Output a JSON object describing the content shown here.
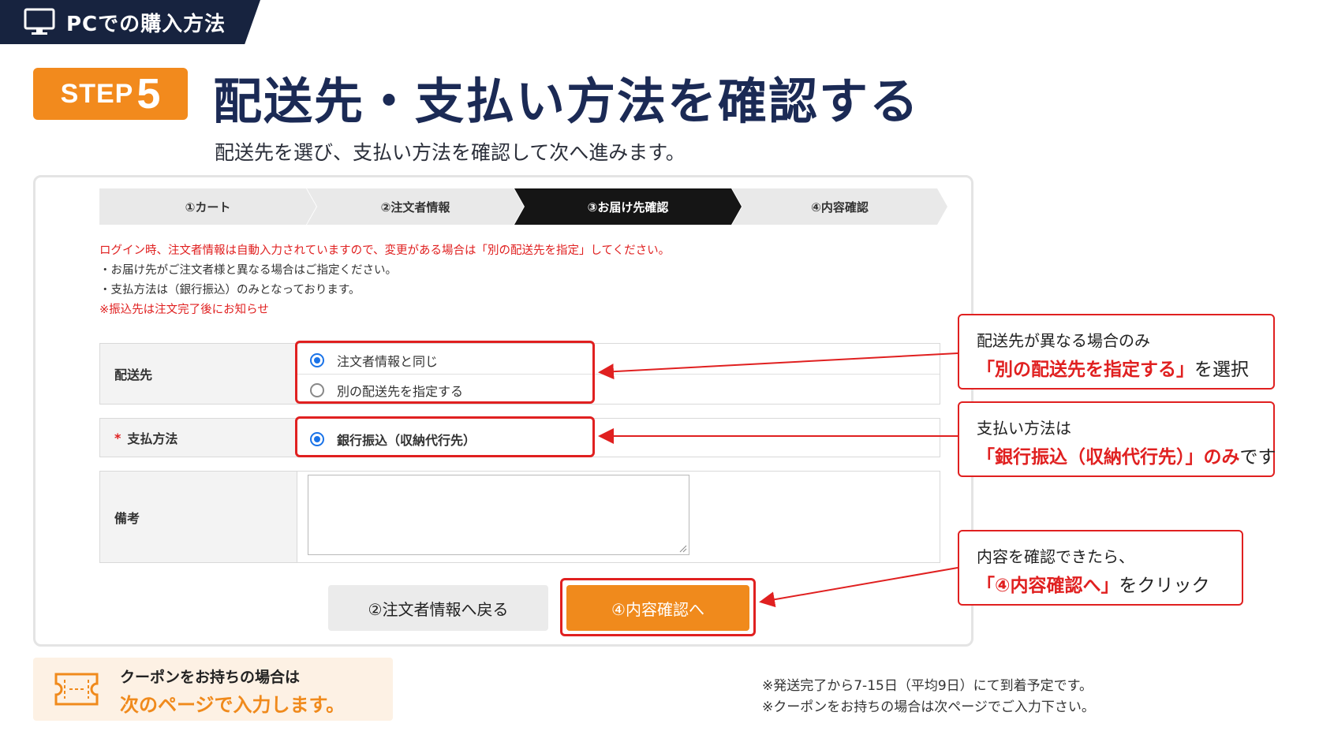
{
  "header": {
    "tab_label": "PCでの購入方法"
  },
  "step": {
    "word": "STEP",
    "number": "5"
  },
  "title": "配送先・支払い方法を確認する",
  "subtitle": "配送先を選び、支払い方法を確認して次へ進みます。",
  "progress": {
    "steps": [
      "①カート",
      "②注文者情報",
      "③お届け先確認",
      "④内容確認"
    ],
    "current": "③お届け先確認"
  },
  "notes": {
    "line1": "ログイン時、注文者情報は自動入力されていますので、変更がある場合は「別の配送先を指定」してください。",
    "line2": "・お届け先がご注文者様と異なる場合はご指定ください。",
    "line3": "・支払方法は（銀行振込）のみとなっております。",
    "line4": "※振込先は注文完了後にお知らせ"
  },
  "form": {
    "shipping": {
      "label": "配送先",
      "options": [
        {
          "label": "注文者情報と同じ",
          "checked": true
        },
        {
          "label": "別の配送先を指定する",
          "checked": false
        }
      ]
    },
    "payment": {
      "required_mark": "*",
      "label": "支払方法",
      "option": {
        "label": "銀行振込（収納代行先）",
        "checked": true
      }
    },
    "remarks": {
      "label": "備考",
      "value": ""
    }
  },
  "buttons": {
    "back": "②注文者情報へ戻る",
    "next": "④内容確認へ"
  },
  "callouts": {
    "c1": {
      "line1": "配送先が異なる場合のみ",
      "line2_em": "「別の配送先を指定する」",
      "line2_rest": "を選択"
    },
    "c2": {
      "line1": "支払い方法は",
      "line2_em": "「銀行振込（収納代行先）」のみ",
      "line2_rest": "です"
    },
    "c3": {
      "line1": "内容を確認できたら、",
      "line2_em": "「④内容確認へ」",
      "line2_rest": "をクリック"
    }
  },
  "coupon": {
    "line1": "クーポンをお持ちの場合は",
    "line2": "次のページで入力します。"
  },
  "footnotes": {
    "line1": "※発送完了から7-15日（平均9日）にて到着予定です。",
    "line2": "※クーポンをお持ちの場合は次ページでご入力下さい。"
  },
  "colors": {
    "navy": "#17233f",
    "orange": "#f08a1c",
    "red": "#e02020",
    "radio_blue": "#1a73e8"
  },
  "icons": [
    "monitor-icon",
    "coupon-ticket-icon"
  ]
}
